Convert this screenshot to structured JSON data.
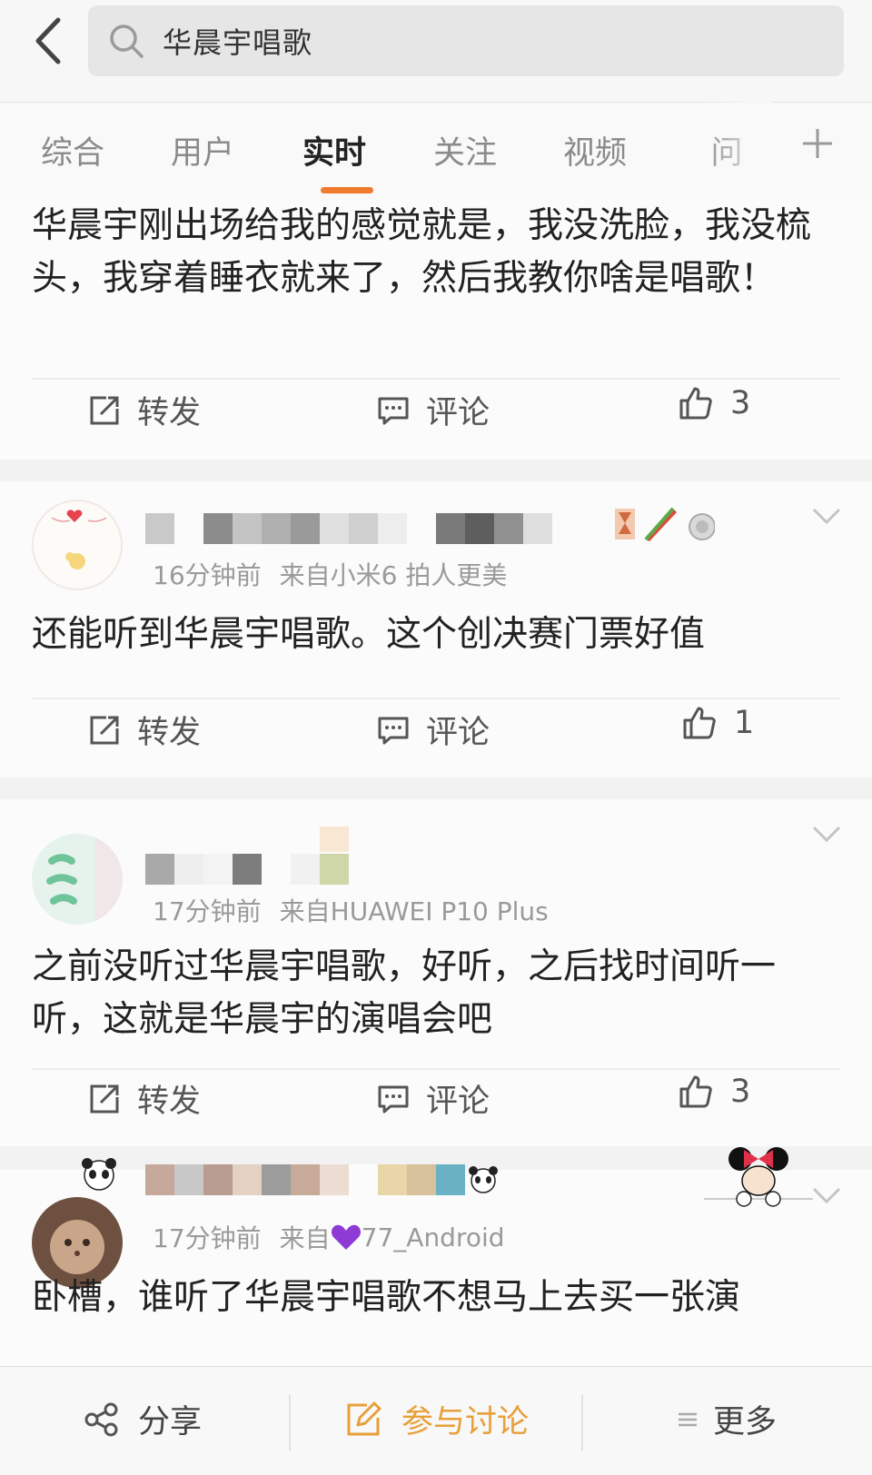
{
  "search": {
    "query": "华晨宇唱歌"
  },
  "tabs": [
    {
      "label": "综合"
    },
    {
      "label": "用户"
    },
    {
      "label": "实时"
    },
    {
      "label": "关注"
    },
    {
      "label": "视频"
    },
    {
      "label": "问"
    }
  ],
  "active_tab": "实时",
  "accent_color": "#f07a2d",
  "posts": [
    {
      "text": "华晨宇刚出场给我的感觉就是，我没洗脸，我没梳头，我穿着睡衣就来了，然后我教你啥是唱歌！",
      "actions": {
        "repost": "转发",
        "comment": "评论",
        "like_count": "3"
      }
    },
    {
      "time": "16分钟前",
      "source": "来自小米6 拍人更美",
      "text": "还能听到华晨宇唱歌。这个创决赛门票好值",
      "actions": {
        "repost": "转发",
        "comment": "评论",
        "like_count": "1"
      }
    },
    {
      "time": "17分钟前",
      "source": "来自HUAWEI P10 Plus",
      "text": "之前没听过华晨宇唱歌，好听，之后找时间听一听，这就是华晨宇的演唱会吧",
      "actions": {
        "repost": "转发",
        "comment": "评论",
        "like_count": "3"
      }
    },
    {
      "time": "17分钟前",
      "source_prefix": "来自",
      "source_name": "77_Android",
      "text": "卧槽，谁听了华晨宇唱歌不想马上去买一张演"
    }
  ],
  "bottom": {
    "share": "分享",
    "discuss": "参与讨论",
    "more": "更多"
  },
  "icons": {
    "back": "back-arrow-icon",
    "search": "search-icon",
    "plus": "plus-icon",
    "repost": "repost-icon",
    "comment": "comment-icon",
    "like": "thumbs-up-icon",
    "share": "share-icon",
    "edit": "edit-icon",
    "more": "menu-icon"
  }
}
